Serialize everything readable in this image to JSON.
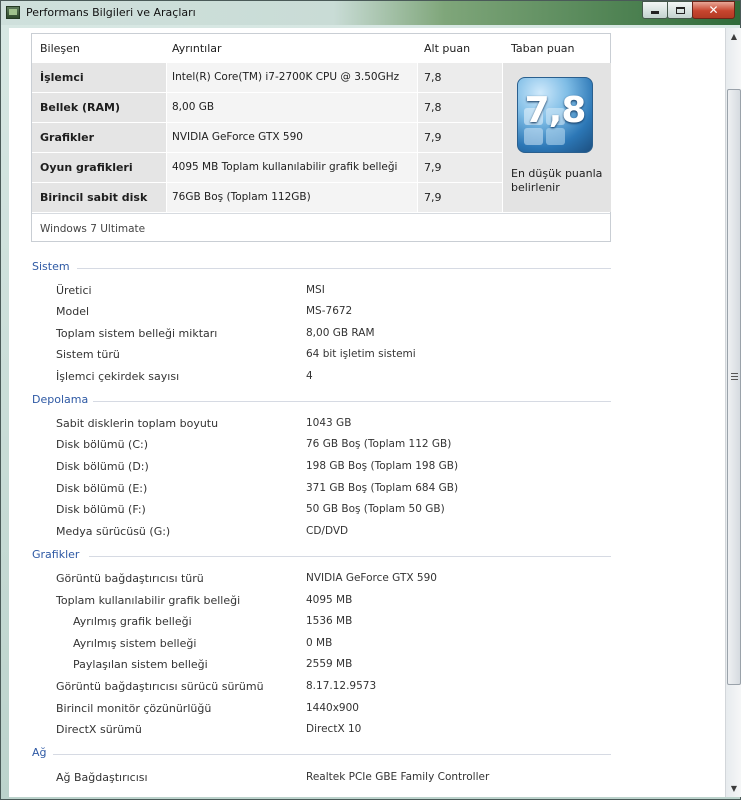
{
  "window": {
    "title": "Performans Bilgileri ve Araçları",
    "minimize_glyph": "",
    "close_glyph": "✕"
  },
  "score_table": {
    "headers": {
      "component": "Bileşen",
      "details": "Ayrıntılar",
      "subscore": "Alt puan",
      "base": "Taban puan"
    },
    "rows": [
      {
        "component": "İşlemci",
        "details": "Intel(R) Core(TM) i7-2700K CPU @ 3.50GHz",
        "score": "7,8"
      },
      {
        "component": "Bellek (RAM)",
        "details": "8,00 GB",
        "score": "7,8"
      },
      {
        "component": "Grafikler",
        "details": "NVIDIA GeForce GTX 590",
        "score": "7,9"
      },
      {
        "component": "Oyun grafikleri",
        "details": "4095 MB Toplam kullanılabilir grafik belleği",
        "score": "7,9"
      },
      {
        "component": "Birincil sabit disk",
        "details": "76GB Boş (Toplam 112GB)",
        "score": "7,9"
      }
    ],
    "base_score": "7,8",
    "base_caption": "En düşük puanla belirlenir",
    "os": "Windows 7 Ultimate"
  },
  "sections": {
    "sistem": {
      "title": "Sistem",
      "items": [
        {
          "label": "Üretici",
          "value": "MSI"
        },
        {
          "label": "Model",
          "value": "MS-7672"
        },
        {
          "label": "Toplam sistem belleği miktarı",
          "value": "8,00 GB RAM"
        },
        {
          "label": "Sistem türü",
          "value": "64 bit işletim sistemi"
        },
        {
          "label": "İşlemci çekirdek sayısı",
          "value": "4"
        }
      ]
    },
    "depolama": {
      "title": "Depolama",
      "items": [
        {
          "label": "Sabit disklerin toplam boyutu",
          "value": "1043 GB"
        },
        {
          "label": "Disk bölümü (C:)",
          "value": "76 GB Boş (Toplam 112 GB)"
        },
        {
          "label": "Disk bölümü (D:)",
          "value": "198 GB Boş (Toplam 198 GB)"
        },
        {
          "label": "Disk bölümü (E:)",
          "value": "371 GB Boş (Toplam 684 GB)"
        },
        {
          "label": "Disk bölümü (F:)",
          "value": "50 GB Boş (Toplam 50 GB)"
        },
        {
          "label": "Medya sürücüsü (G:)",
          "value": "CD/DVD"
        }
      ]
    },
    "grafikler": {
      "title": "Grafikler",
      "items": [
        {
          "label": "Görüntü bağdaştırıcısı türü",
          "value": "NVIDIA GeForce GTX 590"
        },
        {
          "label": "Toplam kullanılabilir grafik belleği",
          "value": "4095 MB"
        },
        {
          "label": "Ayrılmış grafik belleği",
          "value": "1536 MB"
        },
        {
          "label": "Ayrılmış sistem belleği",
          "value": "0 MB"
        },
        {
          "label": "Paylaşılan sistem belleği",
          "value": "2559 MB"
        },
        {
          "label": "Görüntü bağdaştırıcısı sürücü sürümü",
          "value": "8.17.12.9573"
        },
        {
          "label": "Birincil monitör çözünürlüğü",
          "value": "1440x900"
        },
        {
          "label": "DirectX sürümü",
          "value": "DirectX 10"
        }
      ]
    },
    "ag": {
      "title": "Ağ",
      "items": [
        {
          "label": "Ağ Bağdaştırıcısı",
          "value": "Realtek PCIe GBE Family Controller"
        }
      ]
    }
  },
  "colors": {
    "section_title": "#2e59a4",
    "title_bar_accent": "#2f6b39",
    "close_button": "#c7452e"
  },
  "scrollbar": {
    "position_fraction": 0.08
  }
}
